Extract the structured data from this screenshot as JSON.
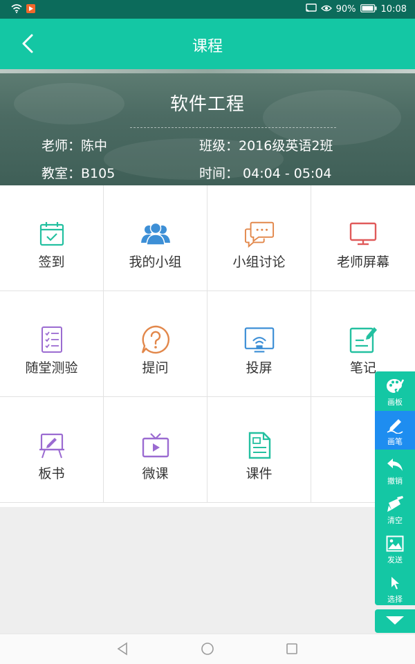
{
  "status_bar": {
    "battery": "90%",
    "time": "10:08",
    "icons": [
      "wifi-icon",
      "app-notification-icon",
      "cast-icon",
      "eye-comfort-icon",
      "battery-icon"
    ]
  },
  "app_bar": {
    "title": "课程",
    "back_icon": "chevron-left-icon"
  },
  "course": {
    "name": "软件工程",
    "teacher": "老师：陈中",
    "class": "班级：2016级英语2班",
    "room": "教室：B105",
    "time": "时间： 04:04 - 05:04"
  },
  "features": [
    {
      "label": "签到",
      "icon": "calendar-check-icon",
      "color": "#23c0a0"
    },
    {
      "label": "我的小组",
      "icon": "group-icon",
      "color": "#3d8fd6"
    },
    {
      "label": "小组讨论",
      "icon": "chat-bubbles-icon",
      "color": "#e2874a"
    },
    {
      "label": "老师屏幕",
      "icon": "monitor-icon",
      "color": "#e05a5a"
    },
    {
      "label": "随堂测验",
      "icon": "checklist-icon",
      "color": "#9b6bd1"
    },
    {
      "label": "提问",
      "icon": "question-icon",
      "color": "#e2874a"
    },
    {
      "label": "投屏",
      "icon": "screen-cast-icon",
      "color": "#3d8fd6"
    },
    {
      "label": "笔记",
      "icon": "note-edit-icon",
      "color": "#23c0a0"
    },
    {
      "label": "板书",
      "icon": "easel-icon",
      "color": "#9b6bd1"
    },
    {
      "label": "微课",
      "icon": "tv-play-icon",
      "color": "#9b6bd1"
    },
    {
      "label": "课件",
      "icon": "document-icon",
      "color": "#23c0a0"
    }
  ],
  "toolbar": {
    "tools": [
      {
        "label": "画板",
        "icon": "palette-icon"
      },
      {
        "label": "画笔",
        "icon": "pen-icon"
      },
      {
        "label": "撤销",
        "icon": "undo-icon"
      },
      {
        "label": "清空",
        "icon": "broom-icon"
      },
      {
        "label": "发送",
        "icon": "image-send-icon"
      },
      {
        "label": "选择",
        "icon": "cursor-icon"
      }
    ],
    "active_tool": "画笔",
    "collapse_icon": "triangle-down-icon",
    "accent": "#14c7a4",
    "active_color": "#1e8df0"
  },
  "nav_bar": {
    "icons": [
      "back-triangle-icon",
      "home-circle-icon",
      "recents-square-icon"
    ]
  }
}
